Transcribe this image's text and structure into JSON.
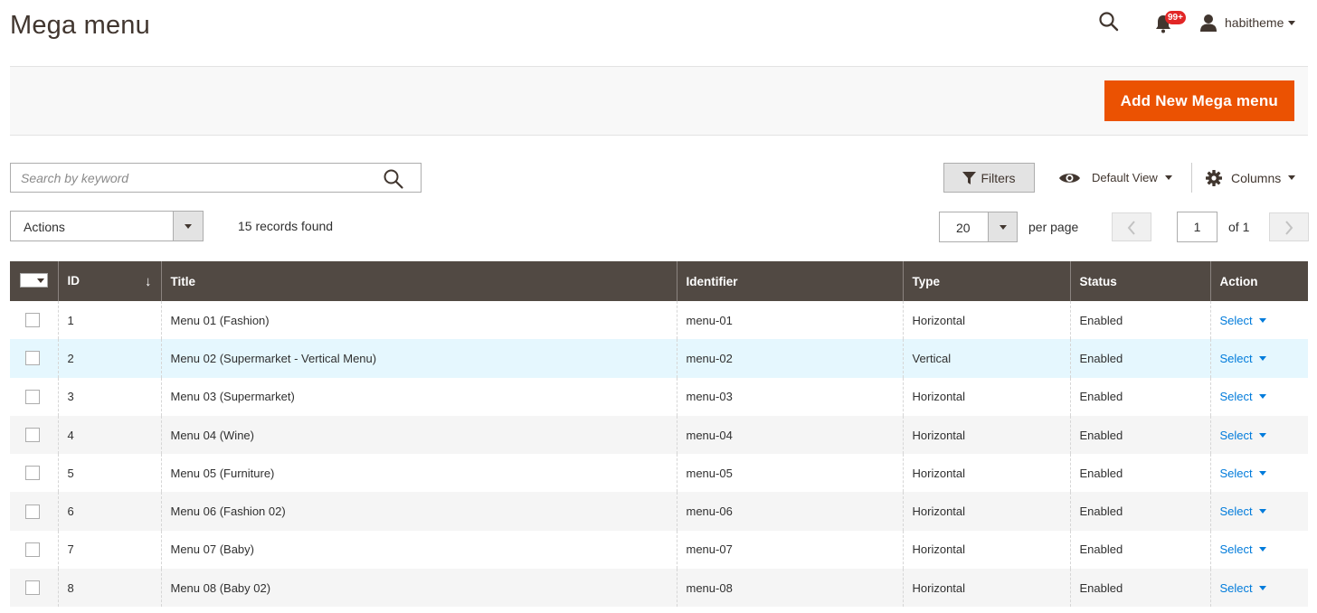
{
  "page": {
    "title": "Mega menu"
  },
  "header": {
    "notifications_count": "99+",
    "username": "habitheme",
    "icons": [
      "search-icon",
      "bell-icon",
      "user-icon"
    ]
  },
  "page_actions": {
    "add_button_label": "Add New Mega menu"
  },
  "toolbar": {
    "search_placeholder": "Search by keyword",
    "filters_label": "Filters",
    "view_label": "Default View",
    "columns_label": "Columns",
    "actions_label": "Actions",
    "records_found": "15 records found",
    "per_page_value": "20",
    "per_page_label": "per page",
    "current_page": "1",
    "page_of": "of 1"
  },
  "colors": {
    "accent": "#eb5202",
    "header_bg": "#514943",
    "link": "#007bdb",
    "highlight_row": "#e5f7fe"
  },
  "grid": {
    "columns": [
      "ID",
      "Title",
      "Identifier",
      "Type",
      "Status",
      "Action"
    ],
    "sort_indicator": "↓",
    "rows": [
      {
        "id": "1",
        "title": "Menu 01 (Fashion)",
        "identifier": "menu-01",
        "type": "Horizontal",
        "status": "Enabled",
        "action": "Select"
      },
      {
        "id": "2",
        "title": "Menu 02 (Supermarket - Vertical Menu)",
        "identifier": "menu-02",
        "type": "Vertical",
        "status": "Enabled",
        "action": "Select"
      },
      {
        "id": "3",
        "title": "Menu 03 (Supermarket)",
        "identifier": "menu-03",
        "type": "Horizontal",
        "status": "Enabled",
        "action": "Select"
      },
      {
        "id": "4",
        "title": "Menu 04 (Wine)",
        "identifier": "menu-04",
        "type": "Horizontal",
        "status": "Enabled",
        "action": "Select"
      },
      {
        "id": "5",
        "title": "Menu 05 (Furniture)",
        "identifier": "menu-05",
        "type": "Horizontal",
        "status": "Enabled",
        "action": "Select"
      },
      {
        "id": "6",
        "title": "Menu 06 (Fashion 02)",
        "identifier": "menu-06",
        "type": "Horizontal",
        "status": "Enabled",
        "action": "Select"
      },
      {
        "id": "7",
        "title": "Menu 07 (Baby)",
        "identifier": "menu-07",
        "type": "Horizontal",
        "status": "Enabled",
        "action": "Select"
      },
      {
        "id": "8",
        "title": "Menu 08 (Baby 02)",
        "identifier": "menu-08",
        "type": "Horizontal",
        "status": "Enabled",
        "action": "Select"
      }
    ]
  }
}
